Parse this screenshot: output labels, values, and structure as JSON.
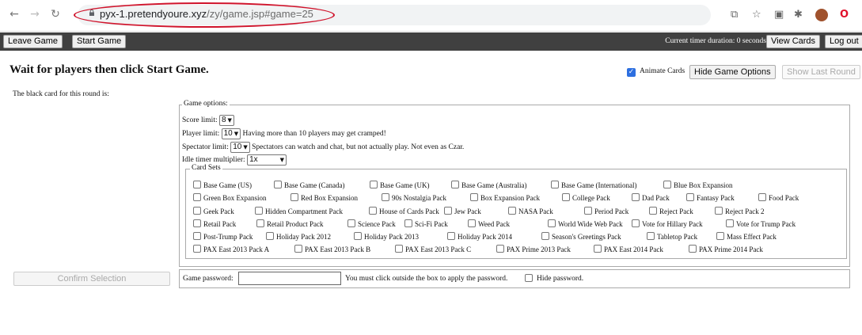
{
  "browser": {
    "url_host": "pyx-1.pretendyoure.xyz",
    "url_path": "/zy/game.jsp#game=25",
    "icons": [
      "back-icon",
      "forward-icon",
      "reload-icon",
      "lock-icon",
      "translate-icon",
      "star-icon",
      "extension-icon",
      "puzzle-icon",
      "profile-icon",
      "opera-icon"
    ],
    "highlight_color": "#d0142c"
  },
  "topbar": {
    "leave_game": "Leave Game",
    "start_game": "Start Game",
    "timer_text": "Current timer duration: 0 seconds",
    "view_cards": "View Cards",
    "log_out": "Log out"
  },
  "main": {
    "headline": "Wait for players then click Start Game.",
    "black_card_label": "The black card for this round is:",
    "animate_cards_label": "Animate Cards",
    "animate_cards_checked": true,
    "hide_game_options": "Hide Game Options",
    "show_last_round": "Show Last Round",
    "confirm_selection": "Confirm Selection"
  },
  "options": {
    "legend": "Game options:",
    "score_limit_label": "Score limit:",
    "score_limit_value": "8",
    "player_limit_label": "Player limit:",
    "player_limit_value": "10",
    "player_limit_note": "Having more than 10 players may get cramped!",
    "spectator_limit_label": "Spectator limit:",
    "spectator_limit_value": "10",
    "spectator_limit_note": "Spectators can watch and chat, but not actually play. Not even as Czar.",
    "idle_timer_label": "Idle timer multiplier:",
    "idle_timer_value": "1x"
  },
  "card_sets": {
    "legend": "Card Sets",
    "rows": [
      [
        "Base Game (US)",
        "Base Game (Canada)",
        "Base Game (UK)",
        "Base Game (Australia)",
        "Base Game (International)",
        "Blue Box Expansion"
      ],
      [
        "Green Box Expansion",
        "Red Box Expansion",
        "90s Nostalgia Pack",
        "Box Expansion Pack",
        "College Pack",
        "Dad Pack",
        "Fantasy Pack",
        "Food Pack"
      ],
      [
        "Geek Pack",
        "Hidden Compartment Pack",
        "House of Cards Pack",
        "Jew Pack",
        "NASA Pack",
        "Period Pack",
        "Reject Pack",
        "Reject Pack 2"
      ],
      [
        "Retail Pack",
        "Retail Product Pack",
        "Science Pack",
        "Sci-Fi Pack",
        "Weed Pack",
        "World Wide Web Pack",
        "Vote for Hillary Pack",
        "Vote for Trump Pack"
      ],
      [
        "Post-Trump Pack",
        "Holiday Pack 2012",
        "Holiday Pack 2013",
        "Holiday Pack 2014",
        "Season's Greetings Pack",
        "Tabletop Pack",
        "Mass Effect Pack"
      ],
      [
        "PAX East 2013 Pack A",
        "PAX East 2013 Pack B",
        "PAX East 2013 Pack C",
        "PAX Prime 2013 Pack",
        "PAX East 2014 Pack",
        "PAX Prime 2014 Pack"
      ]
    ]
  },
  "password": {
    "label": "Game password:",
    "value": "",
    "note": "You must click outside the box to apply the password.",
    "hide_label": "Hide password."
  }
}
